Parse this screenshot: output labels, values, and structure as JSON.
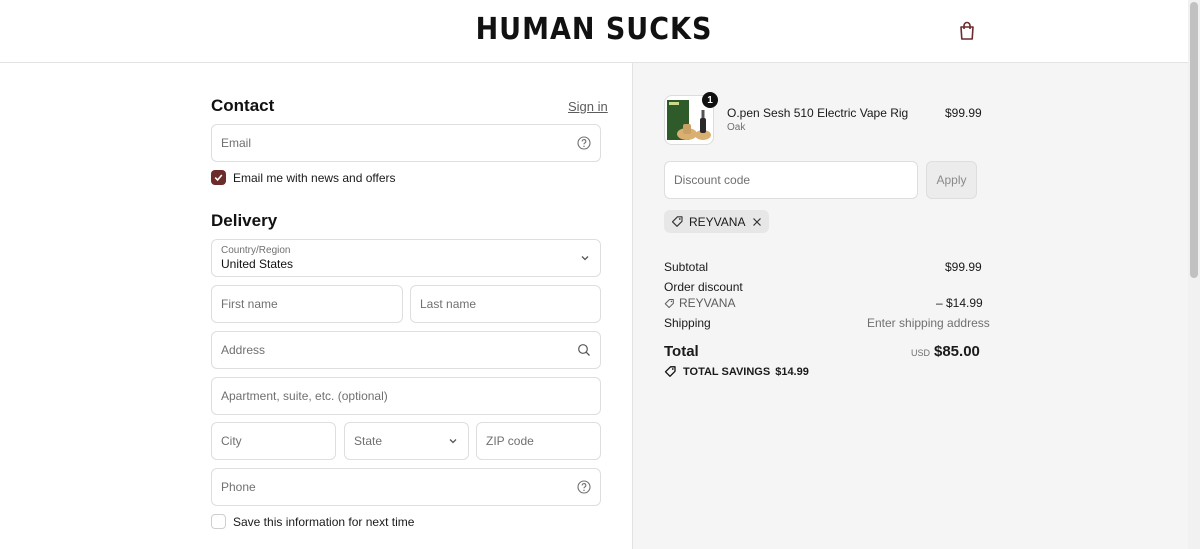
{
  "header": {
    "logo": "HUMAN SUCKS",
    "cart_icon": "shopping-bag-icon"
  },
  "contact": {
    "title": "Contact",
    "sign_in": "Sign in",
    "email_placeholder": "Email",
    "news_label": "Email me with news and offers",
    "news_checked": true
  },
  "delivery": {
    "title": "Delivery",
    "country_label": "Country/Region",
    "country_value": "United States",
    "first_name": "First name",
    "last_name": "Last name",
    "address": "Address",
    "apartment": "Apartment, suite, etc. (optional)",
    "city": "City",
    "state": "State",
    "zip": "ZIP code",
    "phone": "Phone",
    "save_info": "Save this information for next time",
    "save_checked": false
  },
  "cart": {
    "item": {
      "name": "O.pen Sesh 510 Electric Vape Rig",
      "variant": "Oak",
      "price": "$99.99",
      "quantity": "1"
    },
    "discount_placeholder": "Discount code",
    "apply_label": "Apply",
    "applied_code": "REYVANA",
    "subtotal_label": "Subtotal",
    "subtotal_value": "$99.99",
    "order_discount_label": "Order discount",
    "order_discount_code": "REYVANA",
    "order_discount_value": "– $14.99",
    "shipping_label": "Shipping",
    "shipping_value": "Enter shipping address",
    "total_label": "Total",
    "currency": "USD",
    "total_value": "$85.00",
    "savings_label": "TOTAL SAVINGS",
    "savings_value": "$14.99"
  },
  "colors": {
    "accent": "#6b2c2c",
    "summary_bg": "#f5f5f5"
  }
}
